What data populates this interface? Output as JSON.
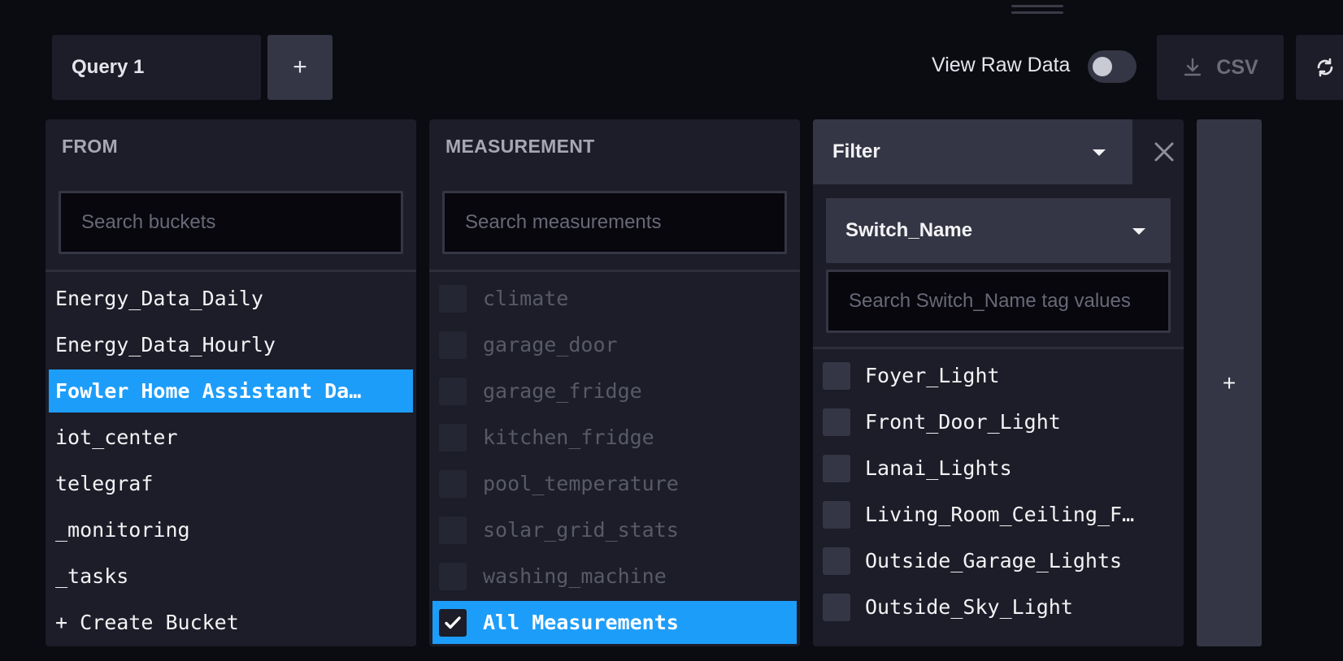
{
  "query_tab": {
    "label": "Query 1",
    "add_label": "+"
  },
  "toolbar": {
    "view_raw_label": "View Raw Data",
    "view_raw_enabled": false,
    "csv_label": "CSV"
  },
  "from_panel": {
    "title": "FROM",
    "search_placeholder": "Search buckets",
    "items": [
      {
        "label": "Energy_Data_Daily",
        "selected": false
      },
      {
        "label": "Energy_Data_Hourly",
        "selected": false
      },
      {
        "label": "Fowler Home Assistant Da…",
        "selected": true
      },
      {
        "label": "iot_center",
        "selected": false
      },
      {
        "label": "telegraf",
        "selected": false
      },
      {
        "label": "_monitoring",
        "selected": false
      },
      {
        "label": "_tasks",
        "selected": false
      },
      {
        "label": "+ Create Bucket",
        "selected": false
      }
    ]
  },
  "measurement_panel": {
    "title": "MEASUREMENT",
    "search_placeholder": "Search measurements",
    "items": [
      {
        "label": "climate",
        "checked": false
      },
      {
        "label": "garage_door",
        "checked": false
      },
      {
        "label": "garage_fridge",
        "checked": false
      },
      {
        "label": "kitchen_fridge",
        "checked": false
      },
      {
        "label": "pool_temperature",
        "checked": false
      },
      {
        "label": "solar_grid_stats",
        "checked": false
      },
      {
        "label": "washing_machine",
        "checked": false
      },
      {
        "label": "All Measurements",
        "checked": true
      }
    ]
  },
  "filter_panel": {
    "function_label": "Filter",
    "tag_key": "Switch_Name",
    "search_placeholder": "Search Switch_Name tag values",
    "items": [
      {
        "label": "Foyer_Light",
        "checked": false
      },
      {
        "label": "Front_Door_Light",
        "checked": false
      },
      {
        "label": "Lanai_Lights",
        "checked": false
      },
      {
        "label": "Living_Room_Ceiling_F…",
        "checked": false
      },
      {
        "label": "Outside_Garage_Lights",
        "checked": false
      },
      {
        "label": "Outside_Sky_Light",
        "checked": false
      }
    ]
  },
  "add_filter_label": "+",
  "colors": {
    "background": "#0b0b12",
    "panel": "#1c1d28",
    "control": "#353645",
    "accent": "#1d9dfa"
  },
  "icons": {
    "csv": "download-icon",
    "refresh": "refresh-icon",
    "close": "close-icon",
    "caret": "caret-down-icon",
    "check": "check-icon"
  }
}
